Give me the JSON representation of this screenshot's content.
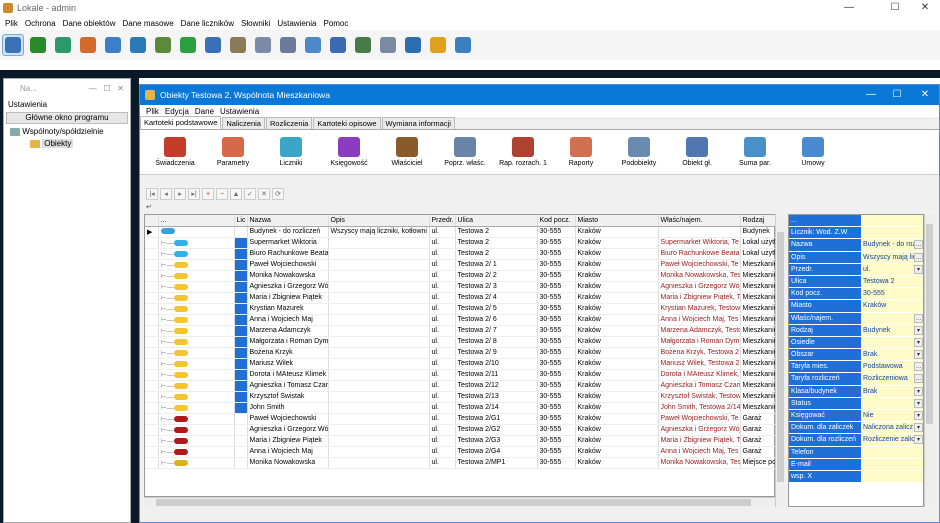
{
  "app": {
    "title": "Lokale - admin"
  },
  "menu": [
    "Plik",
    "Ochrona",
    "Dane obiektów",
    "Dane masowe",
    "Dane liczników",
    "Słowniki",
    "Ustawienia",
    "Pomoc"
  ],
  "toolbar_icons": [
    "building-icon",
    "tree-icon",
    "globe-icon",
    "stamp-icon",
    "book-icon",
    "world-icon",
    "money-icon",
    "earth-icon",
    "book2-icon",
    "scales-icon",
    "document-icon",
    "ruler-icon",
    "chart-icon",
    "box-icon",
    "stack-icon",
    "page-icon",
    "folder-icon",
    "bell-icon",
    "archive-icon"
  ],
  "left_panel": {
    "caption": "Na...",
    "section": "Ustawienia",
    "main_button": "Główne okno programu",
    "tree": {
      "root": "Wspólnoty/spółdzielnie",
      "child": "Obiekty"
    }
  },
  "window": {
    "title": "Obiekty Testowa 2, Wspólnota Mieszkaniowa",
    "menu": [
      "Plik",
      "Edycja",
      "Dane",
      "Ustawienia"
    ],
    "tabs": [
      "Kartoteki podstawowe",
      "Naliczenia",
      "Rozliczenia",
      "Kartoteki opisowe",
      "Wymiana informacji"
    ],
    "active_tab": "Kartoteki podstawowe"
  },
  "big_toolbar": [
    {
      "label": "Świadczenia",
      "icon": "books-icon",
      "color": "#c43d2a"
    },
    {
      "label": "Parametry",
      "icon": "gear-icon",
      "color": "#d46a4a"
    },
    {
      "label": "Liczniki",
      "icon": "meter-icon",
      "color": "#39a6c8"
    },
    {
      "label": "Księgowość",
      "icon": "ledger-icon",
      "color": "#8a3dbf"
    },
    {
      "label": "Właściciel",
      "icon": "owner-icon",
      "color": "#8a5a2a"
    },
    {
      "label": "Poprz. właśc.",
      "icon": "prev-owner-icon",
      "color": "#6a84a8"
    },
    {
      "label": "Rap. rozrach. 1",
      "icon": "report1-icon",
      "color": "#b04030"
    },
    {
      "label": "Raporty",
      "icon": "reports-icon",
      "color": "#d07050"
    },
    {
      "label": "Podobiekty",
      "icon": "subobjects-icon",
      "color": "#6a8ab0"
    },
    {
      "label": "Obiekt gł.",
      "icon": "main-object-icon",
      "color": "#5077b0"
    },
    {
      "label": "Suma par.",
      "icon": "sum-icon",
      "color": "#4a90c8"
    },
    {
      "label": "Umowy",
      "icon": "contract-icon",
      "color": "#4a8ad0"
    }
  ],
  "nav_buttons": [
    "|◂",
    "◂",
    "▸",
    "▸|",
    "+",
    "−",
    "▲",
    "✓",
    "✕",
    "⟳"
  ],
  "grid": {
    "headers": [
      "...",
      "Lic",
      "Nazwa",
      "Opis",
      "Przedr.",
      "Ulica",
      "Kod pocz.",
      "Miasto",
      "Właśc/najem.",
      "Rodzaj"
    ],
    "rows": [
      [
        "budynek",
        "",
        "Budynek - do rozliczeń",
        "Wszyscy mają liczniki, kotłowni",
        "ul.",
        "Testowa 2",
        "30-555",
        "Kraków",
        "",
        "Budynek"
      ],
      [
        "shop",
        "lic",
        "Supermarket Wiktoria",
        "",
        "ul.",
        "Testowa 2",
        "30-555",
        "Kraków",
        "Supermarket Wiktoria, Te",
        "Lokal użytk"
      ],
      [
        "shop",
        "lic",
        "Biuro Rachunkowe Beata",
        "",
        "ul.",
        "Testowa 2",
        "30-555",
        "Kraków",
        "Biuro Rachunkowe Beata",
        "Lokal użytk"
      ],
      [
        "flat",
        "lic",
        "Paweł Wojciechowski",
        "",
        "ul.",
        "Testowa 2/ 1",
        "30-555",
        "Kraków",
        "Paweł Wojciechowski, Te",
        "Mieszkanie"
      ],
      [
        "flat",
        "lic",
        "Monika Nowakowska",
        "",
        "ul.",
        "Testowa 2/ 2",
        "30-555",
        "Kraków",
        "Monika Nowakowska, Tes",
        "Mieszkanie"
      ],
      [
        "flat",
        "lic",
        "Agnieszka i Grzegorz Wój",
        "",
        "ul.",
        "Testowa 2/ 3",
        "30-555",
        "Kraków",
        "Agnieszka i Grzegorz Wój",
        "Mieszkanie"
      ],
      [
        "flat",
        "lic",
        "Maria i Zbigniew Piątek",
        "",
        "ul.",
        "Testowa 2/ 4",
        "30-555",
        "Kraków",
        "Maria i Zbigniew Piątek, T",
        "Mieszkanie"
      ],
      [
        "flat",
        "lic",
        "Krystian Mazurek",
        "",
        "ul.",
        "Testowa 2/ 5",
        "30-555",
        "Kraków",
        "Krystian Mazurek, Testow",
        "Mieszkanie"
      ],
      [
        "flat",
        "lic",
        "Anna i Wojciech Maj",
        "",
        "ul.",
        "Testowa 2/ 6",
        "30-555",
        "Kraków",
        "Anna i Wojciech Maj, Tes",
        "Mieszkanie"
      ],
      [
        "flat",
        "lic",
        "Marzena Adamczyk",
        "",
        "ul.",
        "Testowa 2/ 7",
        "30-555",
        "Kraków",
        "Marzena Adamczyk, Testo",
        "Mieszkanie"
      ],
      [
        "flat",
        "lic",
        "Małgorzata i Roman Dym",
        "",
        "ul.",
        "Testowa 2/ 8",
        "30-555",
        "Kraków",
        "Małgorzata i Roman Dym",
        "Mieszkanie"
      ],
      [
        "flat",
        "lic",
        "Bożena Krzyk",
        "",
        "ul.",
        "Testowa 2/ 9",
        "30-555",
        "Kraków",
        "Bożena Krzyk, Testowa 2",
        "Mieszkanie"
      ],
      [
        "flat",
        "lic",
        "Mariusz Wilek",
        "",
        "ul.",
        "Testowa 2/10",
        "30-555",
        "Kraków",
        "Mariusz Wilek, Testowa 2",
        "Mieszkanie"
      ],
      [
        "flat",
        "lic",
        "Dorota i MAteusz Klimek",
        "",
        "ul.",
        "Testowa 2/11",
        "30-555",
        "Kraków",
        "Dorota i MAteusz Klimek,",
        "Mieszkanie"
      ],
      [
        "flat",
        "lic",
        "Agnieszka i Tomasz Czarn",
        "",
        "ul.",
        "Testowa 2/12",
        "30-555",
        "Kraków",
        "Agnieszka i Tomasz Czarn",
        "Mieszkanie"
      ],
      [
        "flat",
        "lic",
        "Krzysztof Świstak",
        "",
        "ul.",
        "Testowa 2/13",
        "30-555",
        "Kraków",
        "Krzysztof Świstak, Testow",
        "Mieszkanie"
      ],
      [
        "flat",
        "lic",
        "John Smith",
        "",
        "ul.",
        "Testowa 2/14",
        "30-555",
        "Kraków",
        "John Smith, Testowa 2/14",
        "Mieszkanie"
      ],
      [
        "garage",
        "",
        "Paweł Wojciechowski",
        "",
        "ul.",
        "Testowa 2/G1",
        "30-555",
        "Kraków",
        "Paweł Wojciechowski, Te",
        "Garaż"
      ],
      [
        "garage",
        "",
        "Agnieszka i Grzegorz Wój",
        "",
        "ul.",
        "Testowa 2/G2",
        "30-555",
        "Kraków",
        "Agnieszka i Grzegorz Wój",
        "Garaż"
      ],
      [
        "garage",
        "",
        "Maria i Zbigniew Piątek",
        "",
        "ul.",
        "Testowa 2/G3",
        "30-555",
        "Kraków",
        "Maria i Zbigniew Piątek, T",
        "Garaż"
      ],
      [
        "garage",
        "",
        "Anna i Wojciech Maj",
        "",
        "ul.",
        "Testowa 2/G4",
        "30-555",
        "Kraków",
        "Anna i Wojciech Maj, Tes",
        "Garaż"
      ],
      [
        "garage2",
        "",
        "Monika Nowakowska",
        "",
        "ul.",
        "Testowa 2/MP1",
        "30-555",
        "Kraków",
        "Monika Nowakowska, Tes",
        "Miejsce pos"
      ]
    ]
  },
  "props": [
    {
      "label": "...",
      "value": "",
      "dd": ""
    },
    {
      "label": "Licznik: Wod. Z.W.",
      "value": "",
      "dd": ""
    },
    {
      "label": "Nazwa",
      "value": "Budynek - do rozliczeń",
      "dd": "..."
    },
    {
      "label": "Opis",
      "value": "Wszyscy mają liczni",
      "dd": "..."
    },
    {
      "label": "Przedr.",
      "value": "ul.",
      "dd": "▾"
    },
    {
      "label": "Ulica",
      "value": "Testowa 2",
      "dd": ""
    },
    {
      "label": "Kod pocz.",
      "value": "30-555",
      "dd": ""
    },
    {
      "label": "Miasto",
      "value": "Kraków",
      "dd": ""
    },
    {
      "label": "Właśc/najem.",
      "value": "",
      "dd": "..."
    },
    {
      "label": "Rodzaj",
      "value": "Budynek",
      "dd": "▾"
    },
    {
      "label": "Osiedle",
      "value": "",
      "dd": "▾"
    },
    {
      "label": "Obszar",
      "value": "Brak",
      "dd": "▾"
    },
    {
      "label": "Taryfa mies.",
      "value": "Podstawowa",
      "dd": "..."
    },
    {
      "label": "Taryfa rozliczeń",
      "value": "Rozliczeniowa",
      "dd": "..."
    },
    {
      "label": "Klasa/budynek",
      "value": "Brak",
      "dd": "▾"
    },
    {
      "label": "Status",
      "value": "",
      "dd": "▾"
    },
    {
      "label": "Księgować",
      "value": "Nie",
      "dd": "▾"
    },
    {
      "label": "Dokum. dla zaliczek",
      "value": "Naliczona zalicz",
      "dd": "▾"
    },
    {
      "label": "Dokum. dla rozliczeń",
      "value": "Rozliczenie zalic",
      "dd": "▾"
    },
    {
      "label": "Telefon",
      "value": "",
      "dd": ""
    },
    {
      "label": "E-mail",
      "value": "",
      "dd": ""
    },
    {
      "label": "wsp. X",
      "value": "",
      "dd": ""
    }
  ]
}
